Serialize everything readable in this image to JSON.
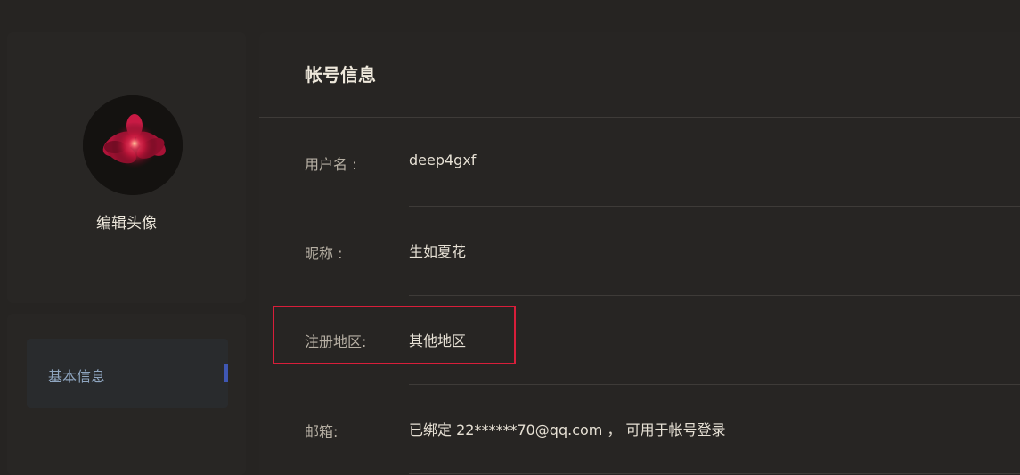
{
  "profile": {
    "edit_avatar_label": "编辑头像"
  },
  "nav": {
    "items": [
      {
        "label": "基本信息",
        "active": true
      }
    ]
  },
  "account": {
    "title": "帐号信息",
    "fields": [
      {
        "label": "用户名 :",
        "value": "deep4gxf"
      },
      {
        "label": "昵称 :",
        "value": "生如夏花"
      },
      {
        "label": "注册地区:",
        "value": "其他地区"
      },
      {
        "label": "邮箱:",
        "value": "已绑定 22******70@qq.com ， 可用于帐号登录"
      }
    ]
  },
  "colors": {
    "background": "#262422",
    "highlight": "#d81e3a",
    "nav_accent": "#3f57b3",
    "nav_text": "#8fa6c0"
  }
}
